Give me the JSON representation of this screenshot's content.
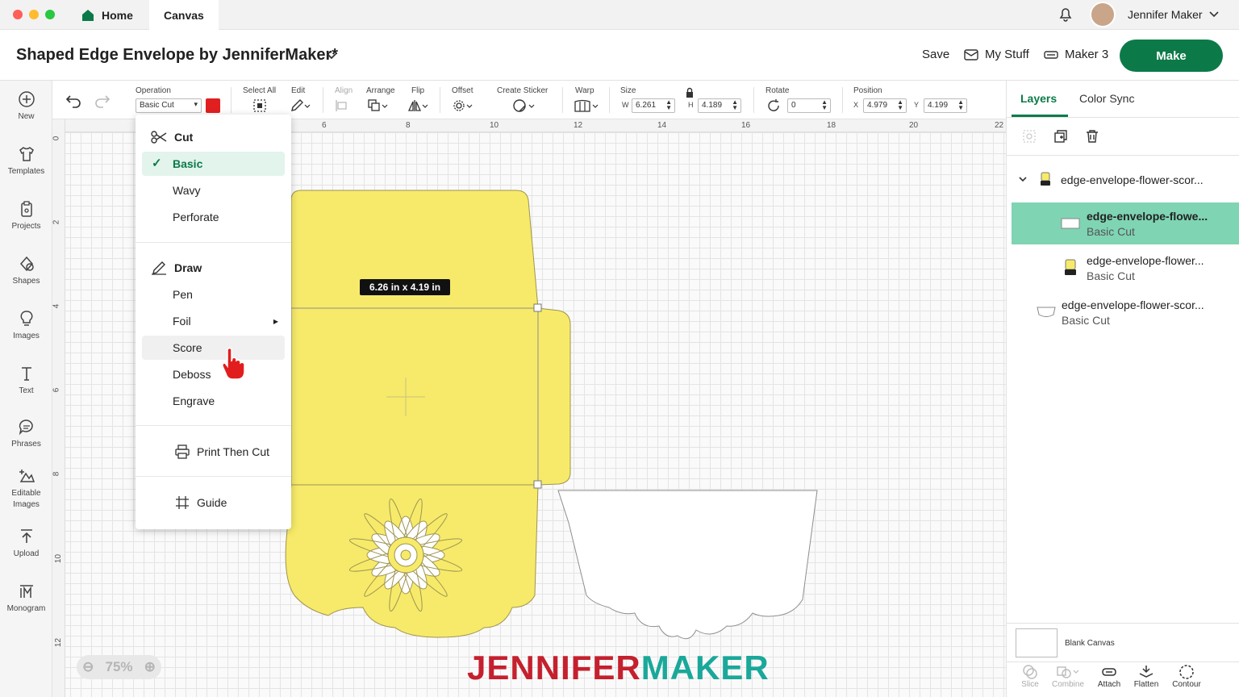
{
  "titlebar": {
    "tab_home": "Home",
    "tab_canvas": "Canvas",
    "user_name": "Jennifer Maker"
  },
  "header": {
    "project_title": "Shaped Edge Envelope by JenniferMaker*",
    "save": "Save",
    "my_stuff": "My Stuff",
    "machine": "Maker 3",
    "make": "Make"
  },
  "leftbar": {
    "items": [
      {
        "label": "New",
        "icon": "plus-circle-icon"
      },
      {
        "label": "Templates",
        "icon": "shirt-icon"
      },
      {
        "label": "Projects",
        "icon": "clipboard-icon"
      },
      {
        "label": "Shapes",
        "icon": "shapes-icon"
      },
      {
        "label": "Images",
        "icon": "bulb-icon"
      },
      {
        "label": "Text",
        "icon": "text-icon"
      },
      {
        "label": "Phrases",
        "icon": "speech-icon"
      },
      {
        "label": "Editable Images",
        "icon": "editable-icon"
      },
      {
        "label": "Upload",
        "icon": "upload-icon"
      },
      {
        "label": "Monogram",
        "icon": "monogram-icon"
      }
    ]
  },
  "toolbar": {
    "operation_label": "Operation",
    "operation_value": "Basic Cut",
    "operation_color": "#e02020",
    "select_all": "Select All",
    "edit": "Edit",
    "align": "Align",
    "arrange": "Arrange",
    "flip": "Flip",
    "offset": "Offset",
    "create_sticker": "Create Sticker",
    "warp": "Warp",
    "size": "Size",
    "w_label": "W",
    "w_value": "6.261",
    "h_label": "H",
    "h_value": "4.189",
    "rotate": "Rotate",
    "rotate_value": "0",
    "position": "Position",
    "x_label": "X",
    "x_value": "4.979",
    "y_label": "Y",
    "y_value": "4.199"
  },
  "ruler": {
    "top": [
      "6",
      "8",
      "10",
      "12",
      "14",
      "16",
      "18",
      "20",
      "22"
    ],
    "left": [
      "0",
      "2",
      "4",
      "6",
      "8",
      "10",
      "12"
    ]
  },
  "canvas": {
    "dimension_badge": "6.26  in x 4.19  in",
    "zoom": "75%",
    "brand_part1": "JENNIFER",
    "brand_part2": "MAKER",
    "brand_color1": "#c5202e",
    "brand_color2": "#1aa89a",
    "fill_color": "#f7ea6a"
  },
  "menu": {
    "cut": "Cut",
    "basic": "Basic",
    "wavy": "Wavy",
    "perforate": "Perforate",
    "draw": "Draw",
    "pen": "Pen",
    "foil": "Foil",
    "score": "Score",
    "deboss": "Deboss",
    "engrave": "Engrave",
    "print_then_cut": "Print Then Cut",
    "guide": "Guide"
  },
  "rightpanel": {
    "tab_layers": "Layers",
    "tab_color_sync": "Color Sync",
    "group_name": "edge-envelope-flower-scor...",
    "layers": [
      {
        "name": "edge-envelope-flowe...",
        "sub": "Basic Cut"
      },
      {
        "name": "edge-envelope-flower...",
        "sub": "Basic Cut"
      },
      {
        "name": "edge-envelope-flower-scor...",
        "sub": "Basic Cut"
      }
    ],
    "blank_canvas": "Blank Canvas",
    "slice": "Slice",
    "combine": "Combine",
    "attach": "Attach",
    "flatten": "Flatten",
    "contour": "Contour"
  },
  "colors": {
    "accent": "#0c7a48",
    "selection": "#7fd4b4"
  }
}
